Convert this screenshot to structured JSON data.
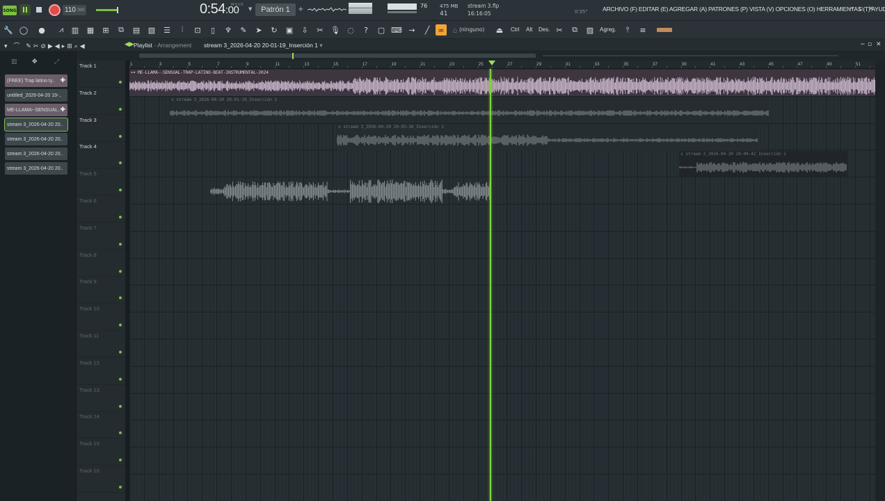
{
  "transport": {
    "mode_badge": "SONG",
    "tempo": "110",
    "tempo_decimals": ".000",
    "time": "0:54",
    "time_sub": ":00",
    "time_unit": "M:S:CS",
    "pattern": "Patrón 1",
    "cpu_value": "76",
    "memory": "475 MB",
    "polyphony": "41",
    "project_file": "stream 3.flp",
    "project_time": "16:16:05",
    "elapsed": "0'35\"",
    "accent_color": "#7ac142",
    "record_color": "#e14b4b"
  },
  "menu": {
    "text": "ARCHIVO (F) EDITAR (E) AGREGAR (A) PATRONES (P) VISTA (V) OPCIONES (O) HERRAMIENTAS (T) AYUDA"
  },
  "toolbar": {
    "snap": "(ninguno)",
    "ctrl": "Ctrl",
    "alt": "Alt",
    "des": "Des.",
    "agreg": "Agreg."
  },
  "playlist": {
    "title": "Playlist",
    "arrangement": "Arrangement",
    "current_clip": "stream 3_2026-04-20 20-01-19_Inserción 1"
  },
  "picker": {
    "items": [
      {
        "label": "(FREE) Trap latino ty..",
        "type": "audio"
      },
      {
        "label": "untitled_2026-04-20 19-..",
        "type": "pattern"
      },
      {
        "label": "ME-LLAMA--SENSUAL..",
        "type": "audio"
      },
      {
        "label": "stream 3_2026-04-20 20..",
        "type": "pattern",
        "active": true
      },
      {
        "label": "stream 3_2026-04-20 20..",
        "type": "pattern"
      },
      {
        "label": "stream 3_2026-04-20 20..",
        "type": "pattern"
      },
      {
        "label": "stream 3_2026-04-20 20..",
        "type": "pattern"
      }
    ]
  },
  "tracks": [
    {
      "name": "Track 1"
    },
    {
      "name": "Track 2"
    },
    {
      "name": "Track 3"
    },
    {
      "name": "Track 4"
    },
    {
      "name": "Track 5"
    },
    {
      "name": "Track 6"
    },
    {
      "name": "Track 7"
    },
    {
      "name": "Track 8"
    },
    {
      "name": "Track 9"
    },
    {
      "name": "Track 10"
    },
    {
      "name": "Track 11"
    },
    {
      "name": "Track 12"
    },
    {
      "name": "Track 13"
    },
    {
      "name": "Track 14"
    },
    {
      "name": "Track 15"
    },
    {
      "name": "Track 16"
    }
  ],
  "ruler": {
    "bars": [
      "1",
      "3",
      "5",
      "7",
      "9",
      "11",
      "13",
      "15",
      "17",
      "19",
      "21",
      "23",
      "25",
      "27",
      "29",
      "31",
      "33",
      "35",
      "37",
      "39",
      "41",
      "43",
      "45",
      "47",
      "49",
      "51"
    ]
  },
  "clips": [
    {
      "title": "ME-LLAMA--SENSUAL-TRAP-LATINO-BEAT-INSTRUMENTAL-2024",
      "track": 1,
      "color": "#c7b4c8"
    },
    {
      "title": "stream 3_2026-04-20 20-01-19_Inserción 1",
      "track": 2,
      "color": "#8b9296"
    },
    {
      "title": "stream 3_2026-04-20 20-03-36_Inserción 1",
      "track": 3,
      "color": "#8b9296"
    },
    {
      "title": "stream 3_2026-04-20 20-04-42_Inserción 1",
      "track": 4,
      "color": "#8b9296"
    },
    {
      "title": "",
      "track": 5,
      "color": "#8b9296"
    }
  ],
  "playhead_bar": 25.5
}
